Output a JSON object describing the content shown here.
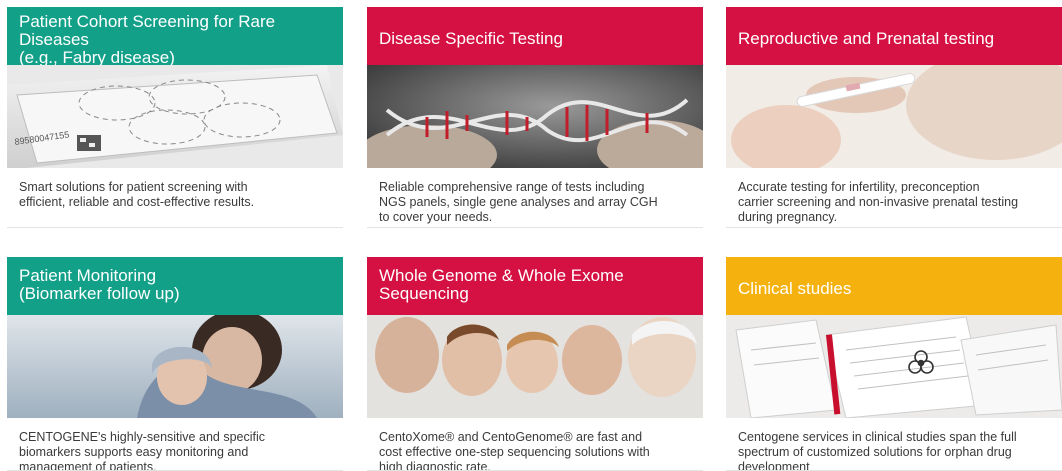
{
  "colors": {
    "teal": "#13a089",
    "red": "#d41142",
    "amber": "#f5b20f"
  },
  "cards": [
    {
      "title_lines": [
        "Patient Cohort Screening for Rare",
        "Diseases",
        "(e.g., Fabry disease)"
      ],
      "description_lines": [
        "Smart solutions for patient screening with",
        "efficient, reliable and cost-effective results."
      ],
      "image": "dried-blood-spot-card"
    },
    {
      "title_lines": [
        "Disease Specific Testing"
      ],
      "description_lines": [
        "Reliable comprehensive range of tests including",
        "NGS panels, single gene analyses and array CGH",
        "to cover your needs."
      ],
      "image": "dna-helix"
    },
    {
      "title_lines": [
        "Reproductive and Prenatal testing"
      ],
      "description_lines": [
        "Accurate testing for infertility, preconception",
        "carrier screening and non-invasive prenatal testing",
        "during pregnancy."
      ],
      "image": "pregnancy-test-hands"
    },
    {
      "title_lines": [
        "Patient Monitoring",
        "(Biomarker follow up)"
      ],
      "description_lines": [
        "CENTOGENE's highly-sensitive and specific",
        "biomarkers supports easy monitoring and",
        "management of patients."
      ],
      "image": "mother-and-child"
    },
    {
      "title_lines": [
        "Whole Genome & Whole Exome",
        "Sequencing"
      ],
      "description_lines": [
        "CentoXome® and CentoGenome® are fast and",
        "cost effective one-step sequencing solutions with",
        "high diagnostic rate."
      ],
      "image": "family-portrait"
    },
    {
      "title_lines": [
        "Clinical studies"
      ],
      "description_lines": [
        "Centogene services in clinical studies span the full",
        "spectrum of customized solutions for orphan drug",
        "development"
      ],
      "image": "biohazard-documents"
    }
  ]
}
